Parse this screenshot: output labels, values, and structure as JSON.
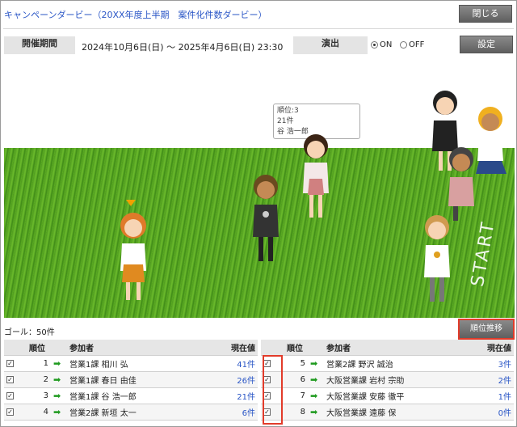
{
  "header": {
    "title": "キャンペーンダービー（20XX年度上半期　案件化件数ダービー）",
    "close_label": "閉じる"
  },
  "period": {
    "label": "開催期間",
    "value": "2024年10月6日(日) ～ 2025年4月6日(日) 23:30"
  },
  "effect": {
    "label": "演出",
    "on_label": "ON",
    "off_label": "OFF",
    "selected": "ON"
  },
  "settings_label": "設定",
  "tooltip": {
    "rank": "順位:3",
    "count": "21件",
    "name": "谷 浩一郎"
  },
  "start_text": "START",
  "goal_text": "ゴール：50件",
  "rank_trend_label": "順位推移",
  "table": {
    "headers": {
      "rank": "順位",
      "participant": "参加者",
      "current": "現在値"
    },
    "left_rows": [
      {
        "rank": "1",
        "name": "営業1課 相川 弘",
        "value": "41件"
      },
      {
        "rank": "2",
        "name": "営業1課 春日 由佳",
        "value": "26件"
      },
      {
        "rank": "3",
        "name": "営業1課 谷 浩一郎",
        "value": "21件"
      },
      {
        "rank": "4",
        "name": "営業2課 新垣 太一",
        "value": "6件"
      }
    ],
    "right_rows": [
      {
        "rank": "5",
        "name": "営業2課 野沢 誠治",
        "value": "3件"
      },
      {
        "rank": "6",
        "name": "大阪営業課 岩村 宗助",
        "value": "2件"
      },
      {
        "rank": "7",
        "name": "大阪営業課 安藤 徹平",
        "value": "1件"
      },
      {
        "rank": "8",
        "name": "大阪営業課 遠藤 保",
        "value": "0件"
      }
    ]
  },
  "colors": {
    "title": "#2a56c6",
    "highlight": "#e23b2a",
    "grass": "#5fb024"
  }
}
